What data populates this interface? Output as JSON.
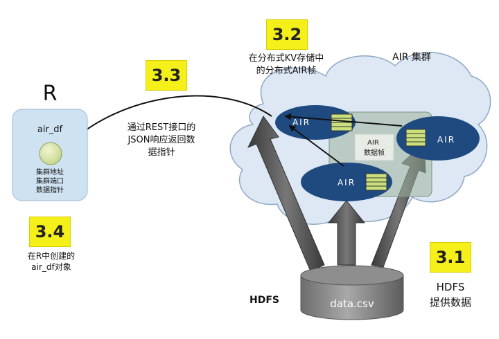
{
  "badges": {
    "b31": "3.1",
    "b32": "3.2",
    "b33": "3.3",
    "b34": "3.4"
  },
  "r_panel": {
    "title": "R",
    "object_label": "air_df",
    "lines": [
      "集群地址",
      "集群端口",
      "数据指针"
    ]
  },
  "captions": {
    "kv_line1": "在分布式KV存储中",
    "kv_line2": "的分布式AIR帧",
    "cluster_label": "AIR 集群",
    "rest_line1": "通过REST接口的",
    "rest_line2": "JSON响应返回数",
    "rest_line3": "据指针",
    "create_line1": "在R中创建的",
    "create_line2": "air_df对象",
    "hdfs_left": "HDFS",
    "hdfs_right_line1": "HDFS",
    "hdfs_right_line2": "提供数据"
  },
  "cluster": {
    "nodes": [
      "AIR",
      "AIR",
      "AIR"
    ],
    "frame_label_line1": "AIR",
    "frame_label_line2": "数据帧"
  },
  "storage": {
    "file": "data.csv"
  },
  "colors": {
    "badge": "#f5ef1a",
    "cloud": "#dce7f4",
    "node": "#1f4a80",
    "r_panel": "#cfe2f1"
  }
}
